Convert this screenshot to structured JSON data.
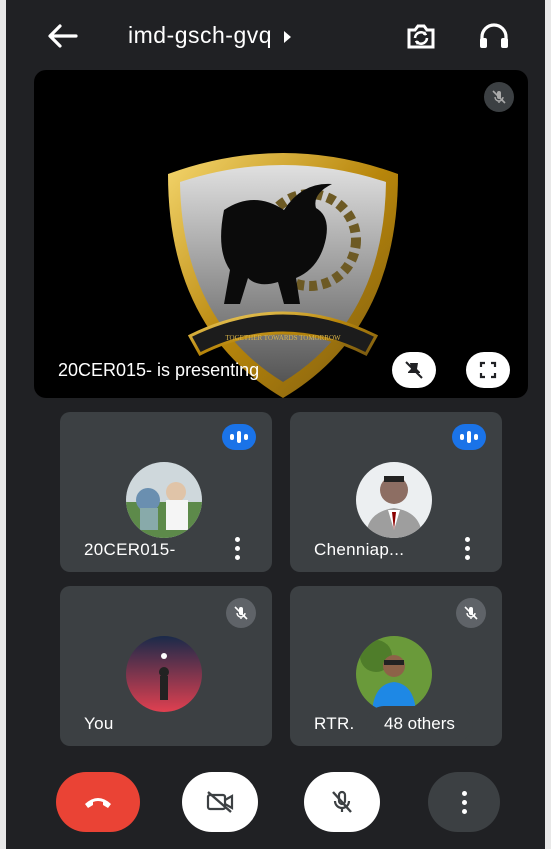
{
  "header": {
    "meeting_code": "imd-gsch-gvq",
    "icons": [
      "back-arrow-icon",
      "caret-right-icon",
      "switch-camera-icon",
      "headphones-icon"
    ]
  },
  "presentation": {
    "presenter_text": "20CER015- is presenting",
    "emblem_motto": "TOGETHER TOWARDS TOMORROW",
    "icons": [
      "mic-off-icon",
      "unpin-icon",
      "fullscreen-icon"
    ]
  },
  "participants": [
    {
      "name": "20CER015-",
      "state": "speaking"
    },
    {
      "name": "Chenniap...",
      "state": "speaking"
    },
    {
      "name": "You",
      "state": "muted"
    },
    {
      "name": "RTR.",
      "state": "muted"
    }
  ],
  "others_label": "48 others",
  "controls": {
    "icons": [
      "end-call-icon",
      "camera-off-icon",
      "mic-off-icon",
      "more-options-icon"
    ]
  },
  "colors": {
    "background": "#202124",
    "tile": "#3c4043",
    "speaking": "#1a73e8",
    "end_call": "#ea4335"
  }
}
